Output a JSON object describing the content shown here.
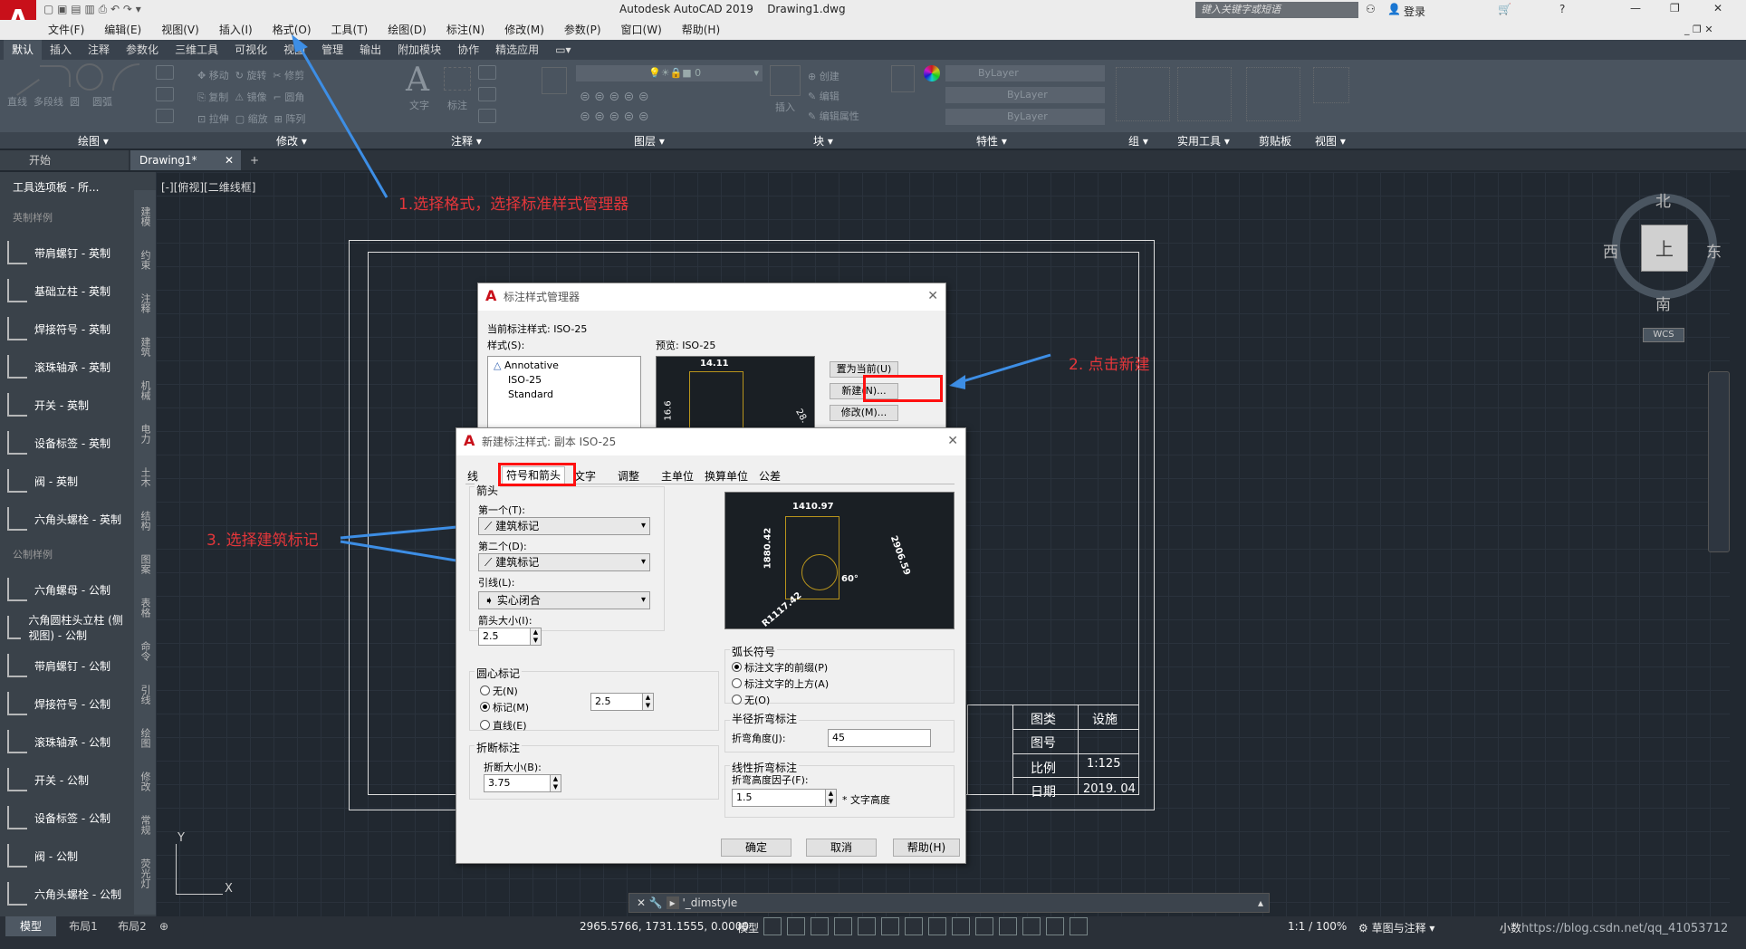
{
  "app": {
    "title": "Autodesk AutoCAD 2019",
    "file": "Drawing1.dwg",
    "search_placeholder": "键入关键字或短语",
    "login": "登录"
  },
  "menu": [
    "文件(F)",
    "编辑(E)",
    "视图(V)",
    "插入(I)",
    "格式(O)",
    "工具(T)",
    "绘图(D)",
    "标注(N)",
    "修改(M)",
    "参数(P)",
    "窗口(W)",
    "帮助(H)"
  ],
  "ribbon_tabs": [
    "默认",
    "插入",
    "注释",
    "参数化",
    "三维工具",
    "可视化",
    "视图",
    "管理",
    "输出",
    "附加模块",
    "协作",
    "精选应用"
  ],
  "ribbon_panels": [
    "绘图",
    "修改",
    "注释",
    "图层",
    "块",
    "特性",
    "组",
    "实用工具",
    "剪贴板",
    "视图"
  ],
  "ribbon": {
    "layer_value": "0",
    "prop_bylayer": "ByLayer",
    "tools_draw": [
      "直线",
      "多段线",
      "圆",
      "圆弧"
    ],
    "tools_mod": [
      "移动",
      "旋转",
      "修剪",
      "复制",
      "镜像",
      "圆角",
      "拉伸",
      "缩放",
      "阵列"
    ],
    "annot": [
      "文字",
      "标注"
    ],
    "insert": "插入",
    "create": "创建",
    "edit": "编辑",
    "edit_attr": "编辑属性",
    "match": "特性匹配"
  },
  "file_tabs": [
    "开始",
    "Drawing1*"
  ],
  "palette": {
    "title": "工具选项板 - 所...",
    "section1": "英制样例",
    "section2": "公制样例",
    "items1": [
      "带肩螺钉 - 英制",
      "基础立柱 - 英制",
      "焊接符号 - 英制",
      "滚珠轴承 - 英制",
      "开关 - 英制",
      "设备标签 - 英制",
      "阀 - 英制",
      "六角头螺栓 - 英制"
    ],
    "items2": [
      "六角螺母 - 公制",
      "六角圆柱头立柱 (侧视图) - 公制",
      "带肩螺钉 - 公制",
      "焊接符号 - 公制",
      "滚珠轴承 - 公制",
      "开关 - 公制",
      "设备标签 - 公制",
      "阀 - 公制",
      "六角头螺栓 - 公制"
    ],
    "strip": [
      "建模",
      "约束",
      "注释",
      "建筑",
      "机械",
      "电力",
      "土木",
      "结构",
      "图案",
      "表格",
      "命令",
      "引线",
      "绘图",
      "修改",
      "常规",
      "荧光灯"
    ]
  },
  "viewport_label": "[-][俯视][二维线框]",
  "viewcube": {
    "north": "北",
    "south": "南",
    "east": "东",
    "west": "西",
    "top": "上",
    "wcs": "WCS"
  },
  "titleblock": {
    "r1a": "图类",
    "r1b": "设施",
    "r2a": "图号",
    "r3a": "比例",
    "r3b": "1:125",
    "r4a": "日期",
    "r4b": "2019. 04"
  },
  "annotations": {
    "a1": "1.选择格式，选择标准样式管理器",
    "a2": "2. 点击新建",
    "a3": "3. 选择建筑标记"
  },
  "dsm": {
    "title": "标注样式管理器",
    "current": "当前标注样式: ISO-25",
    "styles_label": "样式(S):",
    "styles": [
      "Annotative",
      "ISO-25",
      "Standard"
    ],
    "preview": "预览: ISO-25",
    "set_current": "置为当前(U)",
    "new": "新建(N)...",
    "modify": "修改(M)..."
  },
  "nds": {
    "title": "新建标注样式: 副本 ISO-25",
    "tabs": [
      "线",
      "符号和箭头",
      "文字",
      "调整",
      "主单位",
      "换算单位",
      "公差"
    ],
    "arrows": "箭头",
    "first": "第一个(T):",
    "first_val": "建筑标记",
    "second": "第二个(D):",
    "second_val": "建筑标记",
    "leader": "引线(L):",
    "leader_val": "实心闭合",
    "size": "箭头大小(I):",
    "size_val": "2.5",
    "center": "圆心标记",
    "none": "无(N)",
    "mark": "标记(M)",
    "line": "直线(E)",
    "center_val": "2.5",
    "break": "折断标注",
    "break_size": "折断大小(B):",
    "break_val": "3.75",
    "arc": "弧长符号",
    "arc1": "标注文字的前缀(P)",
    "arc2": "标注文字的上方(A)",
    "arc3": "无(O)",
    "jog": "半径折弯标注",
    "jog_angle": "折弯角度(J):",
    "jog_val": "45",
    "linjog": "线性折弯标注",
    "linjog_factor": "折弯高度因子(F):",
    "linjog_val": "1.5",
    "text_height": "* 文字高度",
    "ok": "确定",
    "cancel": "取消",
    "help": "帮助(H)",
    "dims": {
      "d1": "1410.97",
      "d2": "1880.42",
      "d3": "2906.59",
      "d4": "60°",
      "d5": "R1117.42"
    }
  },
  "dsm_dims": {
    "d1": "14.11",
    "d2": "16.6",
    "d3": "28."
  },
  "command": {
    "text": "'_dimstyle"
  },
  "status": {
    "coords": "2965.5766, 1731.1555, 0.0000",
    "model": "模型",
    "scale": "1:1 / 100%",
    "workspace": "草图与注释",
    "units": "小数",
    "layout_tabs": [
      "模型",
      "布局1",
      "布局2"
    ],
    "watermark": "https://blog.csdn.net/qq_41053712"
  }
}
